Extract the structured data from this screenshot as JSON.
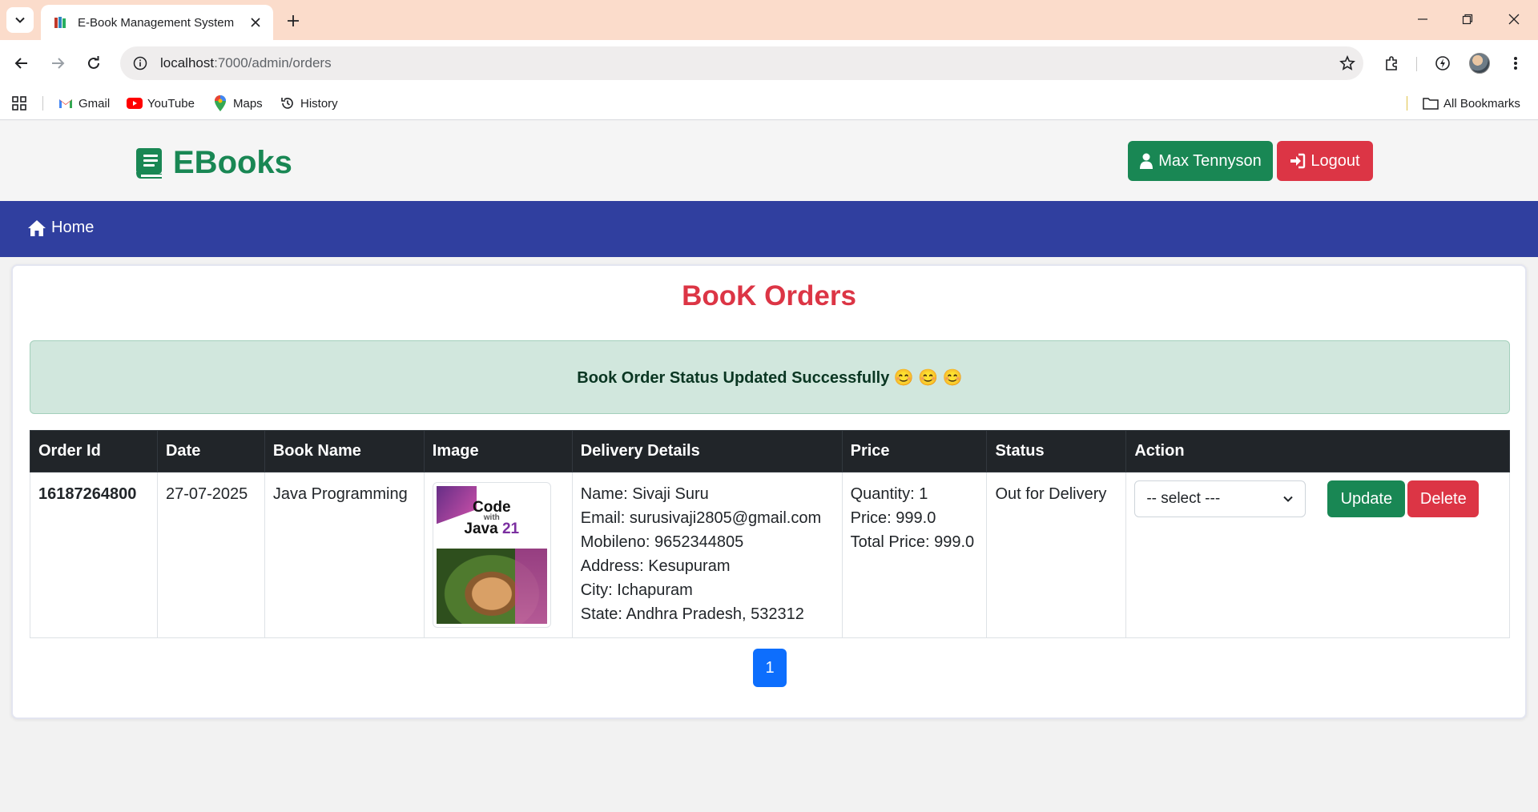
{
  "browser": {
    "tab_title": "E-Book Management System",
    "url_host": "localhost",
    "url_path": ":7000/admin/orders",
    "bookmarks": [
      {
        "label": "Gmail",
        "icon": "gmail-icon"
      },
      {
        "label": "YouTube",
        "icon": "youtube-icon"
      },
      {
        "label": "Maps",
        "icon": "maps-icon"
      },
      {
        "label": "History",
        "icon": "history-icon"
      }
    ],
    "all_bookmarks_label": "All Bookmarks"
  },
  "header": {
    "brand": "EBooks",
    "user_button": "Max Tennyson",
    "logout_button": "Logout"
  },
  "nav": {
    "home": "Home"
  },
  "main": {
    "title": "BooK Orders",
    "alert": "Book Order Status Updated Successfully 😊 😊 😊",
    "columns": [
      "Order Id",
      "Date",
      "Book Name",
      "Image",
      "Delivery Details",
      "Price",
      "Status",
      "Action"
    ],
    "rows": [
      {
        "order_id": "16187264800",
        "date": "27-07-2025",
        "book_name": "Java Programming",
        "cover": {
          "title_line1": "Code",
          "title_with": "with",
          "title_line2": "Java",
          "title_num": "21"
        },
        "delivery": {
          "name": "Name: Sivaji Suru",
          "email": "Email: surusivaji2805@gmail.com",
          "mobile": "Mobileno: 9652344805",
          "address": "Address: Kesupuram",
          "city": "City: Ichapuram",
          "state": "State: Andhra Pradesh, 532312"
        },
        "price": {
          "quantity": "Quantity: 1",
          "price": "Price: 999.0",
          "total": "Total Price: 999.0"
        },
        "status": "Out for Delivery",
        "select_value": "-- select ---",
        "update_label": "Update",
        "delete_label": "Delete"
      }
    ],
    "pagination": [
      "1"
    ]
  },
  "colors": {
    "brand_green": "#198754",
    "danger_red": "#dc3545",
    "navbar_blue": "#303f9f",
    "primary_blue": "#0d6efd",
    "tabstrip": "#fbdccb"
  }
}
